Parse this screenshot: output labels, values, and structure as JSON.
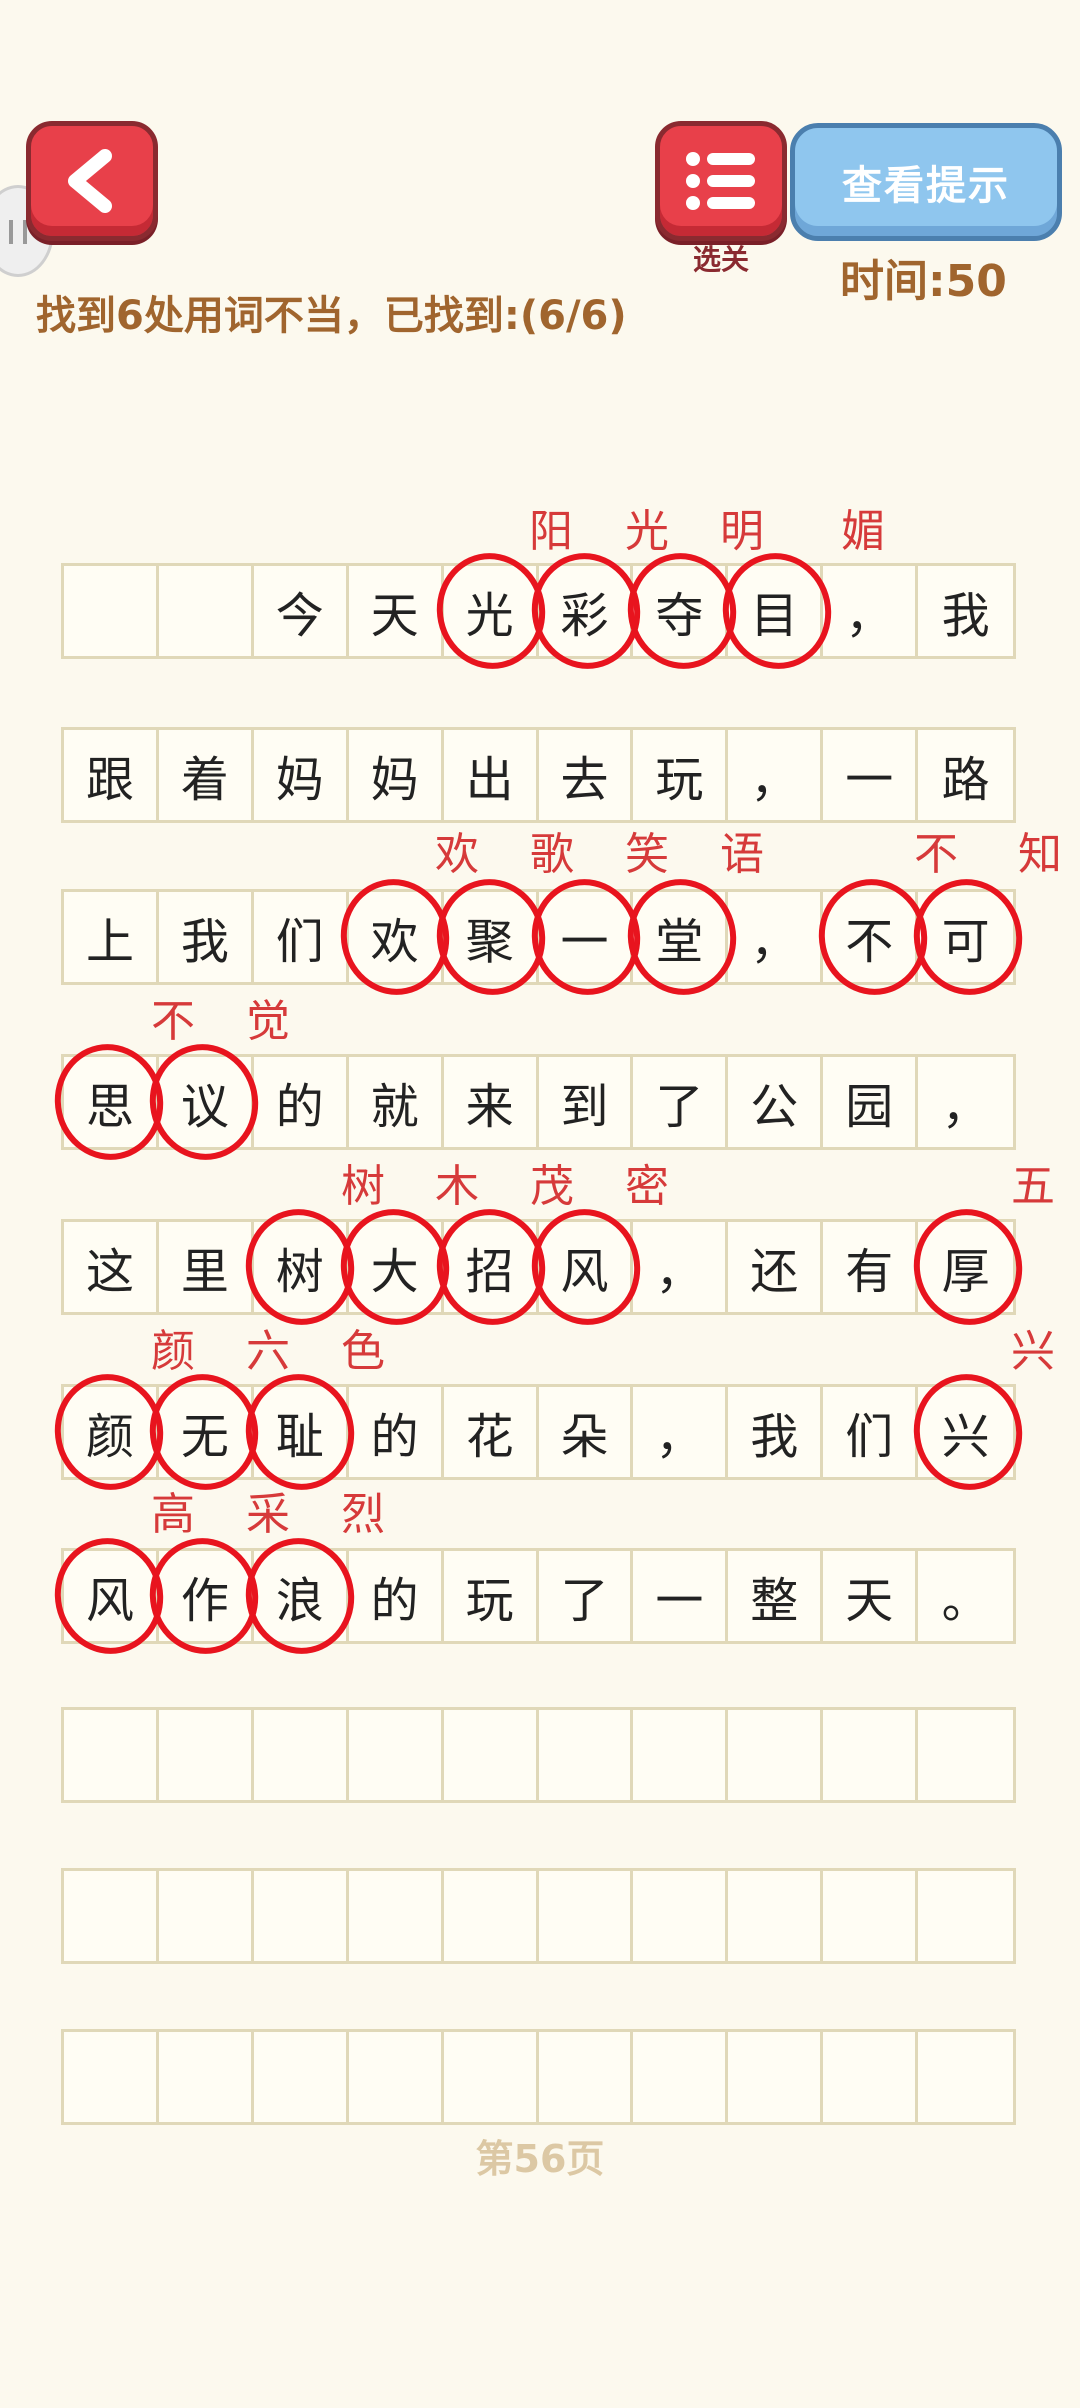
{
  "header": {
    "levels_label": "选关",
    "hint_label": "查看提示",
    "timer": "时间:50",
    "task": "找到6处用词不当，已找到:(6/6)"
  },
  "grid_rows": [
    [
      "",
      "",
      "今",
      "天",
      "光",
      "彩",
      "夺",
      "目",
      "，",
      "我"
    ],
    [
      "跟",
      "着",
      "妈",
      "妈",
      "出",
      "去",
      "玩",
      "，",
      "一",
      "路"
    ],
    [
      "上",
      "我",
      "们",
      "欢",
      "聚",
      "一",
      "堂",
      "，",
      "不",
      "可"
    ],
    [
      "思",
      "议",
      "的",
      "就",
      "来",
      "到",
      "了",
      "公",
      "园",
      "，"
    ],
    [
      "这",
      "里",
      "树",
      "大",
      "招",
      "风",
      "，",
      "还",
      "有",
      "厚"
    ],
    [
      "颜",
      "无",
      "耻",
      "的",
      "花",
      "朵",
      "，",
      "我",
      "们",
      "兴"
    ],
    [
      "风",
      "作",
      "浪",
      "的",
      "玩",
      "了",
      "一",
      "整",
      "天",
      "。"
    ],
    [
      "",
      "",
      "",
      "",
      "",
      "",
      "",
      "",
      "",
      ""
    ],
    [
      "",
      "",
      "",
      "",
      "",
      "",
      "",
      "",
      "",
      ""
    ],
    [
      "",
      "",
      "",
      "",
      "",
      "",
      "",
      "",
      "",
      ""
    ]
  ],
  "corrections": [
    "阳",
    "光",
    "明",
    "媚",
    "欢",
    "歌",
    "笑",
    "语",
    "不",
    "知",
    "不",
    "觉",
    "树",
    "木",
    "茂",
    "密",
    "五",
    "颜",
    "六",
    "色",
    "兴",
    "高",
    "采",
    "烈"
  ],
  "footer": {
    "page": "第56页"
  },
  "colors": {
    "circle": "#e8141e",
    "correction": "#d63a3a",
    "button_red": "#e8404a",
    "button_blue": "#8fc6ee",
    "accent_brown": "#a0652e"
  }
}
